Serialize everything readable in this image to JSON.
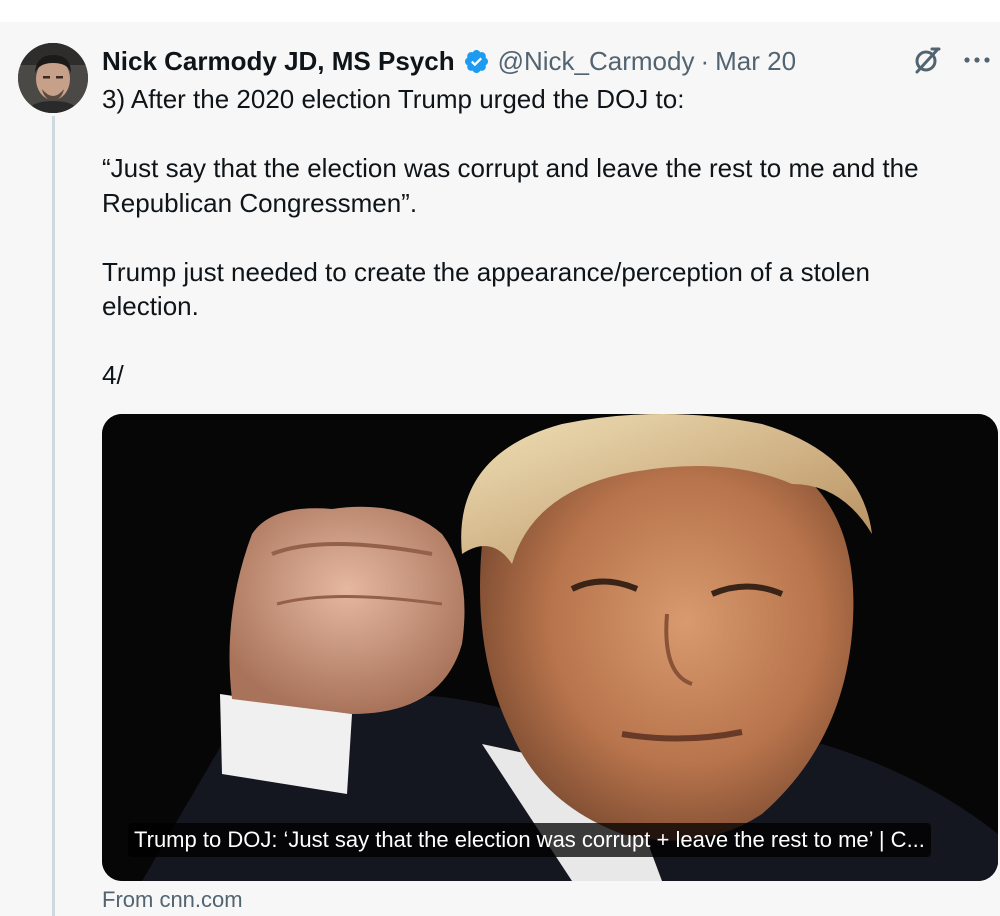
{
  "tweet": {
    "author_name": "Nick Carmody JD, MS Psych",
    "handle": "@Nick_Carmody",
    "separator": "·",
    "date": "Mar 20",
    "more_label": "···",
    "text": {
      "line1": "3) After the 2020 election Trump urged the DOJ to:",
      "line2": "“Just say that the election was corrupt and leave the rest to me and the",
      "line3": "Republican Congressmen”.",
      "line4": "Trump just needed to create the appearance/perception of a stolen",
      "line5": "election.",
      "line6": "4/"
    },
    "card": {
      "caption": "Trump to DOJ: ‘Just say that the election was corrupt + leave the rest to me’ | C...",
      "source": "From cnn.com"
    }
  },
  "colors": {
    "background": "#f7f7f7",
    "verified_badge": "#1d9bf0",
    "secondary_text": "#536471",
    "thread_line": "#cfd9de"
  },
  "icons": {
    "verified": "verified-badge-icon",
    "grok": "grok-icon",
    "more": "more-options-icon"
  }
}
